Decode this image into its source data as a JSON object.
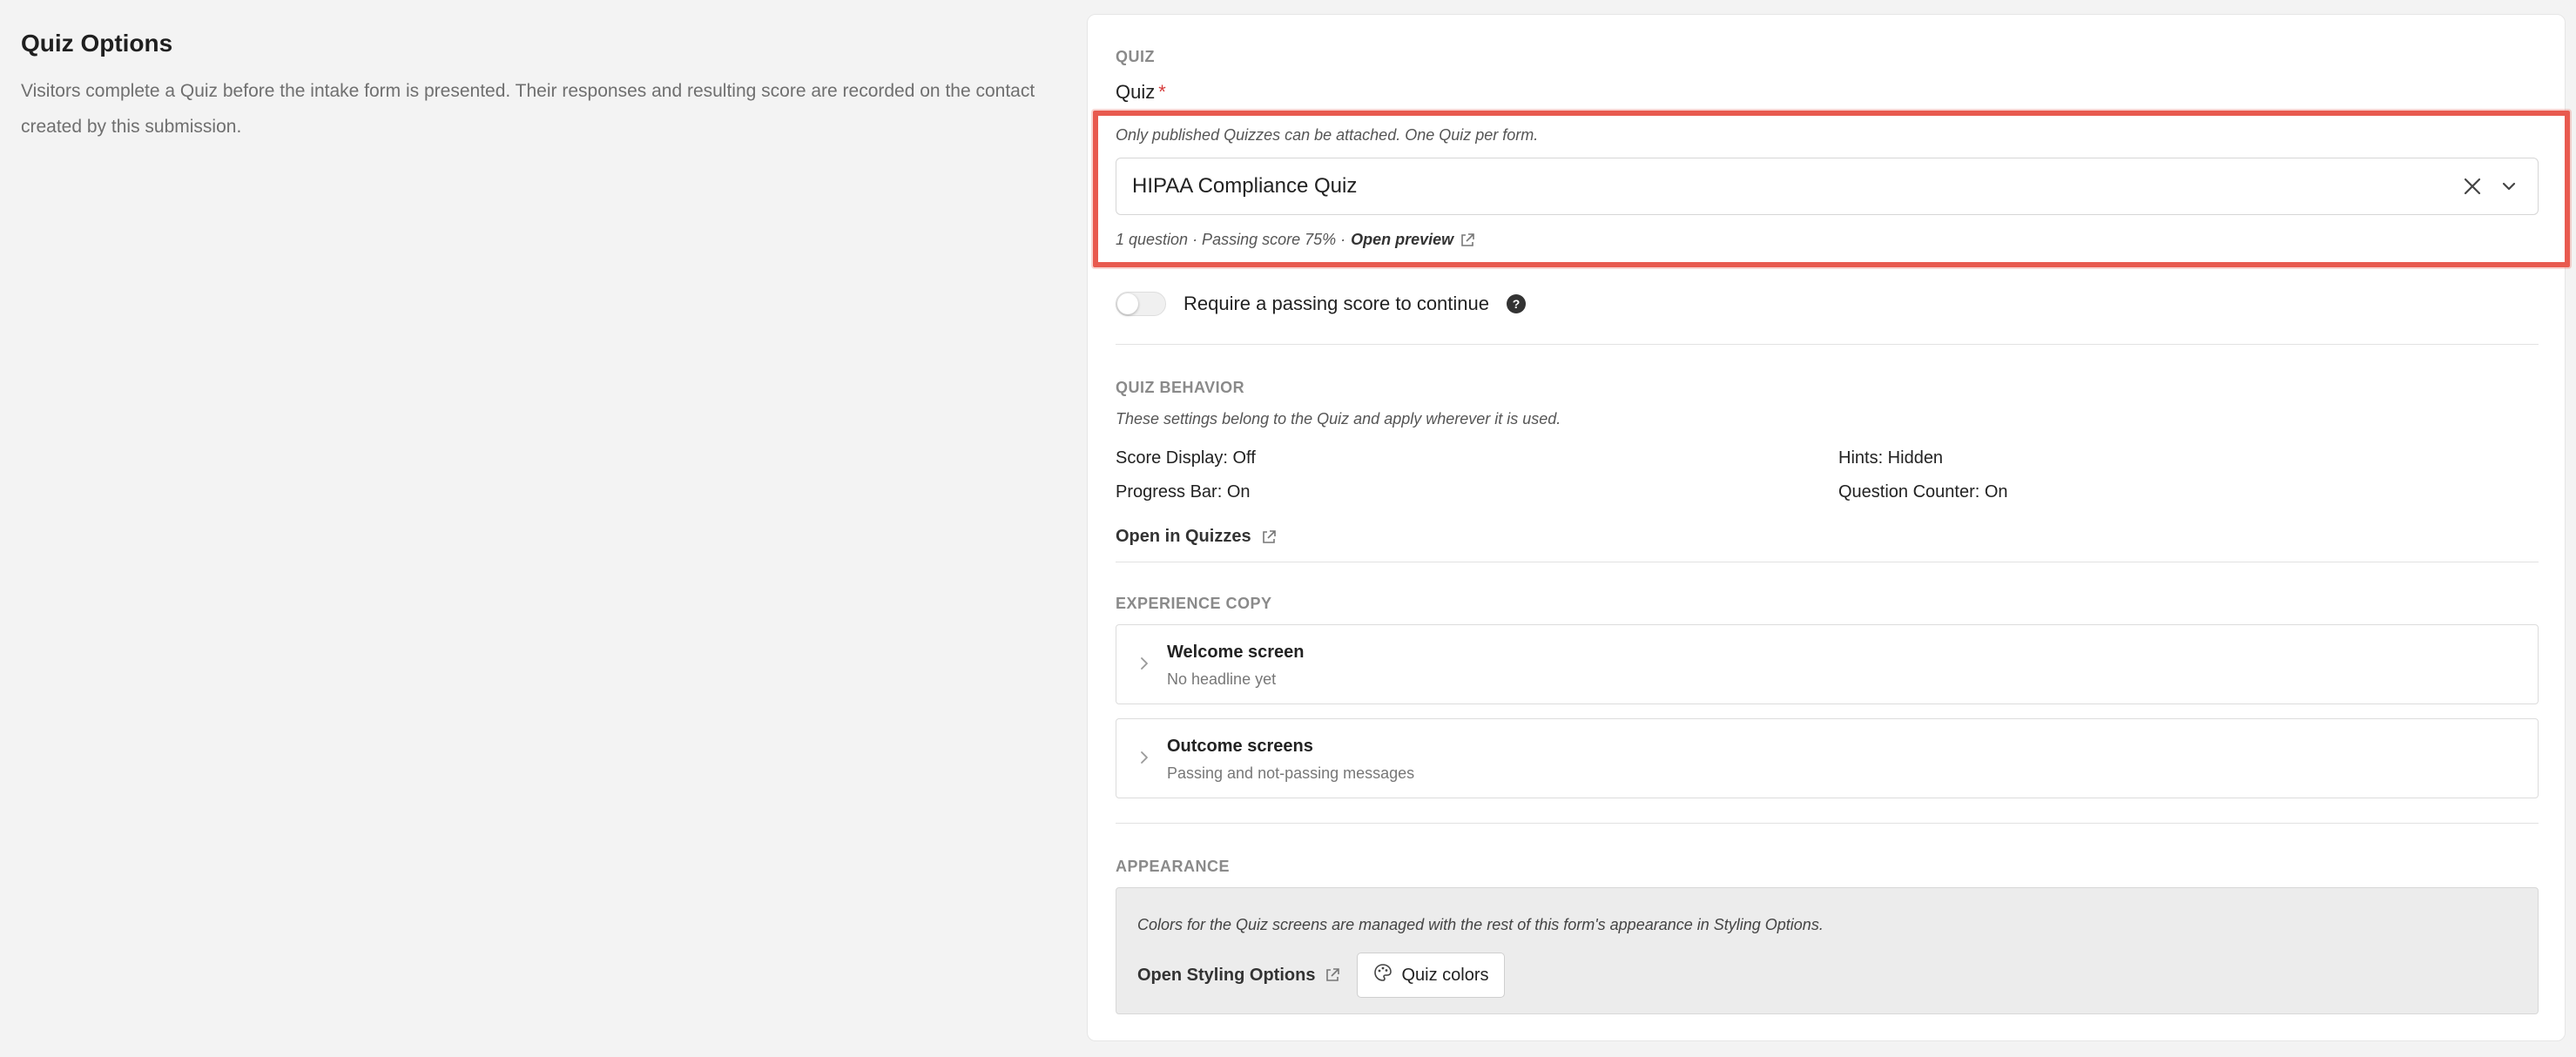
{
  "intro": {
    "title": "Quiz Options",
    "description": "Visitors complete a Quiz before the intake form is presented. Their responses and resulting score are recorded on the contact created by this submission."
  },
  "quiz_section": {
    "label": "QUIZ",
    "field_label": "Quiz",
    "required_marker": "*",
    "hint": "Only published Quizzes can be attached. One Quiz per form.",
    "selected_value": "HIPAA Compliance Quiz",
    "meta_text": "1 question · Passing score 75% ·",
    "preview_link": "Open preview",
    "toggle_label": "Require a passing score to continue",
    "toggle_on": false,
    "help_glyph": "?"
  },
  "behavior": {
    "label": "QUIZ BEHAVIOR",
    "note": "These settings belong to the Quiz and apply wherever it is used.",
    "score_display": "Score Display: Off",
    "hints": "Hints: Hidden",
    "progress_bar": "Progress Bar: On",
    "question_counter": "Question Counter: On",
    "open_link": "Open in Quizzes"
  },
  "experience": {
    "label": "EXPERIENCE COPY",
    "items": [
      {
        "title": "Welcome screen",
        "subtitle": "No headline yet"
      },
      {
        "title": "Outcome screens",
        "subtitle": "Passing and not-passing messages"
      }
    ]
  },
  "appearance": {
    "label": "APPEARANCE",
    "note": "Colors for the Quiz screens are managed with the rest of this form's appearance in Styling Options.",
    "styling_link": "Open Styling Options",
    "colors_button": "Quiz colors"
  },
  "colors": {
    "highlight": "#e85a4f",
    "required": "#d63b3b"
  }
}
